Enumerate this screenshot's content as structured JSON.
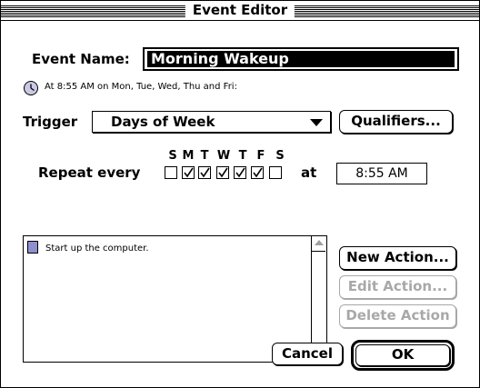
{
  "window": {
    "title": "Event Editor"
  },
  "event": {
    "name_label": "Event Name:",
    "name_value": "Morning Wakeup",
    "summary": "At 8:55 AM on Mon, Tue, Wed, Thu and Fri:"
  },
  "trigger": {
    "label": "Trigger",
    "selected": "Days of Week",
    "qualifiers_button": "Qualifiers..."
  },
  "repeat": {
    "label": "Repeat every",
    "days": [
      {
        "letter": "S",
        "checked": false
      },
      {
        "letter": "M",
        "checked": true
      },
      {
        "letter": "T",
        "checked": true
      },
      {
        "letter": "W",
        "checked": true
      },
      {
        "letter": "T",
        "checked": true
      },
      {
        "letter": "F",
        "checked": true
      },
      {
        "letter": "S",
        "checked": false
      }
    ],
    "at_label": "at",
    "time": "8:55 AM"
  },
  "actions": {
    "items": [
      {
        "label": "Start up the computer."
      }
    ],
    "new_button": "New Action...",
    "edit_button": "Edit Action...",
    "delete_button": "Delete Action"
  },
  "footer": {
    "cancel_button": "Cancel",
    "ok_button": "OK"
  },
  "colors": {
    "disabled_text": "#a8a8a8",
    "icon_fill": "#8f8fd0"
  },
  "icons": {
    "clock": "clock-icon",
    "action_doc": "document-icon"
  }
}
